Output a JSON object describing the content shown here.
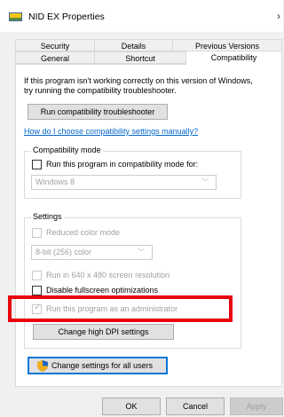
{
  "window": {
    "title": "NID EX Properties",
    "close_glyph": "›",
    "app_icon": "app-shortcut-icon"
  },
  "tabs_row1": [
    {
      "label": "Security"
    },
    {
      "label": "Details"
    },
    {
      "label": "Previous Versions"
    }
  ],
  "tabs_row2": [
    {
      "label": "General"
    },
    {
      "label": "Shortcut"
    },
    {
      "label": "Compatibility",
      "active": true
    }
  ],
  "intro": {
    "line1": "If this program isn't working correctly on this version of Windows,",
    "line2": "try running the compatibility troubleshooter."
  },
  "troubleshooter_button": "Run compatibility troubleshooter",
  "manual_link": "How do I choose compatibility settings manually?",
  "compat_mode": {
    "title": "Compatibility mode",
    "checkbox_label": "Run this program in compatibility mode for:",
    "checked": false,
    "select_value": "Windows 8"
  },
  "settings": {
    "title": "Settings",
    "reduced_color": {
      "label": "Reduced color mode",
      "checked": false,
      "enabled": false
    },
    "color_select": "8-bit (256) color",
    "res_640": {
      "label": "Run in 640 x 480 screen resolution",
      "checked": false,
      "enabled": false
    },
    "fullscreen": {
      "label": "Disable fullscreen optimizations",
      "checked": false,
      "enabled": true
    },
    "admin": {
      "label": "Run this program as an administrator",
      "checked": true,
      "enabled": false
    },
    "dpi_button": "Change high DPI settings"
  },
  "all_users_button": {
    "label": "Change settings for all users",
    "icon": "shield-icon"
  },
  "footer": {
    "ok": "OK",
    "cancel": "Cancel",
    "apply": "Apply"
  },
  "colors": {
    "highlight": "#e8000b",
    "link": "#0066cc",
    "focus": "#0078d7"
  }
}
